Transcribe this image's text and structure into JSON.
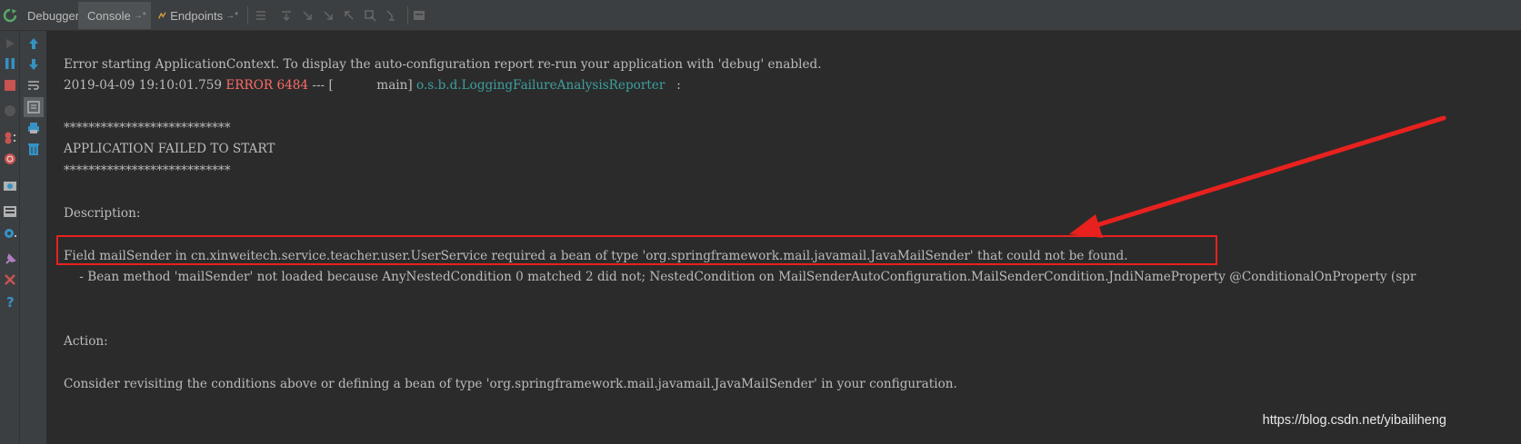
{
  "tabs": [
    {
      "label": "Debugger"
    },
    {
      "label": "Console",
      "pin": "→*"
    },
    {
      "label": "Endpoints",
      "pin": "→*"
    }
  ],
  "console": {
    "line1": "Error starting ApplicationContext. To display the auto-configuration report re-run your application with 'debug' enabled.",
    "log_timestamp": "2019-04-09 19:10:01.759 ",
    "log_level": "ERROR",
    "log_pid": " 6484",
    "log_sep": " --- [           main] ",
    "log_class": "o.s.b.d.LoggingFailureAnalysisReporter",
    "log_colon": "   :",
    "stars1": "***************************",
    "app_failed": "APPLICATION FAILED TO START",
    "stars2": "***************************",
    "description_label": "Description:",
    "field_line": "Field mailSender in cn.xinweitech.service.teacher.user.UserService required a bean of type 'org.springframework.mail.javamail.JavaMailSender' that could not be found.",
    "bean_line": "    - Bean method 'mailSender' not loaded because AnyNestedCondition 0 matched 2 did not; NestedCondition on MailSenderAutoConfiguration.MailSenderCondition.JndiNameProperty @ConditionalOnProperty (spr",
    "action_label": "Action:",
    "consider_line": "Consider revisiting the conditions above or defining a bean of type 'org.springframework.mail.javamail.JavaMailSender' in your configuration."
  },
  "watermark": "https://blog.csdn.net/yibailiheng",
  "colors": {
    "background": "#2b2b2b",
    "text": "#bbbbbb",
    "error": "#ff6b68",
    "class_name": "#3d9f9f",
    "annotation_red": "#e8211f"
  },
  "icons": {
    "top": [
      "rerun-icon",
      "console-icon",
      "endpoints-icon",
      "show-execution-point-icon",
      "step-over-icon",
      "step-into-icon",
      "force-step-into-icon",
      "step-out-icon",
      "drop-frame-icon",
      "run-to-cursor-icon",
      "evaluate-icon"
    ],
    "gutter1": [
      "resume-icon",
      "pause-icon",
      "stop-icon",
      "disabled-icon",
      "view-breakpoints-icon",
      "mute-breakpoints-icon",
      "camera-icon",
      "layout-icon",
      "settings-icon",
      "pin-icon",
      "close-icon",
      "help-icon"
    ],
    "gutter2": [
      "up-arrow-icon",
      "down-arrow-icon",
      "soft-wrap-icon",
      "scroll-to-end-icon",
      "print-icon",
      "clear-icon"
    ]
  }
}
